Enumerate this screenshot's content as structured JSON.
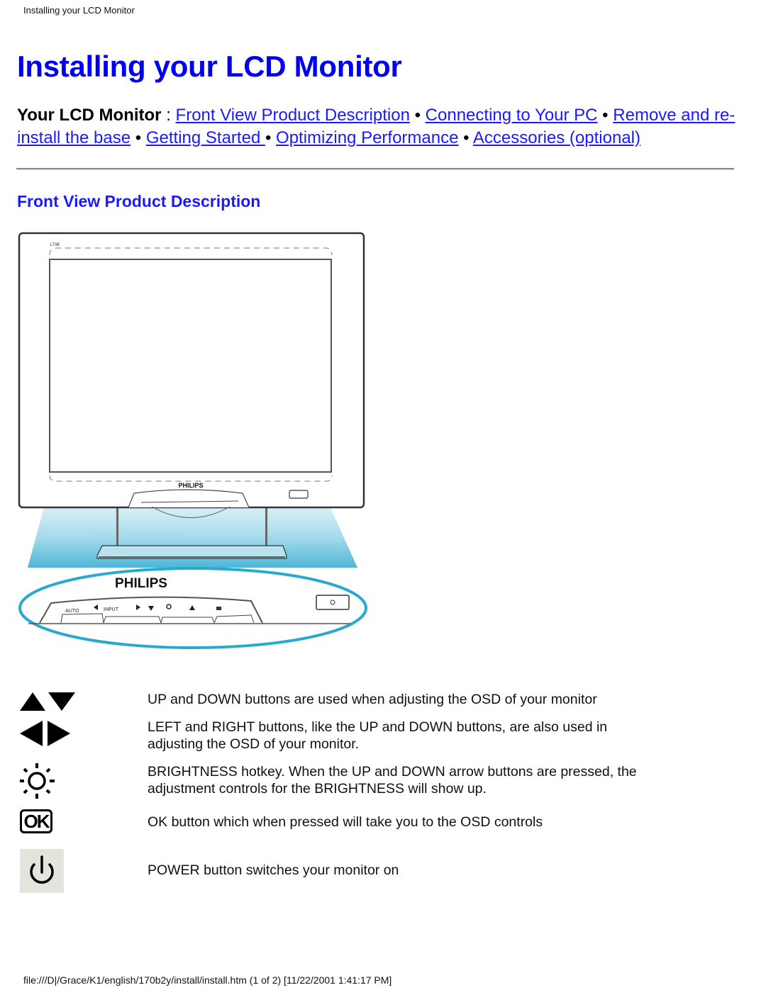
{
  "header": {
    "page_title": "Installing your LCD Monitor"
  },
  "main": {
    "title": "Installing your LCD Monitor",
    "nav": {
      "prefix": "Your LCD Monitor",
      "separator_colon": " : ",
      "bullet": " • ",
      "links": [
        "Front View Product Description",
        "Connecting to Your PC",
        "Remove and re-install the base",
        "Getting Started ",
        "Optimizing Performance",
        "Accessories (optional)"
      ]
    },
    "section_title": "Front View Product Description",
    "figure": {
      "brand_label": "PHILIPS",
      "model_label": "170B",
      "button_labels": [
        "AUTO",
        "INPUT"
      ]
    },
    "legend": [
      {
        "icon": "up-down-arrows-icon",
        "text": "UP and DOWN buttons are used when adjusting the OSD of your monitor"
      },
      {
        "icon": "left-right-arrows-icon",
        "text": "LEFT and RIGHT buttons, like the UP and DOWN buttons, are also used in adjusting the OSD of your monitor."
      },
      {
        "icon": "brightness-sun-icon",
        "text": "BRIGHTNESS hotkey. When the UP and DOWN arrow buttons are pressed, the adjustment controls for the BRIGHTNESS will show up."
      },
      {
        "icon": "ok-icon",
        "icon_text": "OK",
        "text": "OK button which when pressed will take you to the OSD controls"
      },
      {
        "icon": "power-icon",
        "text": "POWER button switches your monitor on"
      }
    ]
  },
  "footer": {
    "text": "file:///D|/Grace/K1/english/170b2y/install/install.htm (1 of 2) [11/22/2001 1:41:17 PM]"
  },
  "colors": {
    "heading_blue": "#0000f0",
    "link_blue": "#1a1aff",
    "beam_cyan": "#29a9cf"
  }
}
